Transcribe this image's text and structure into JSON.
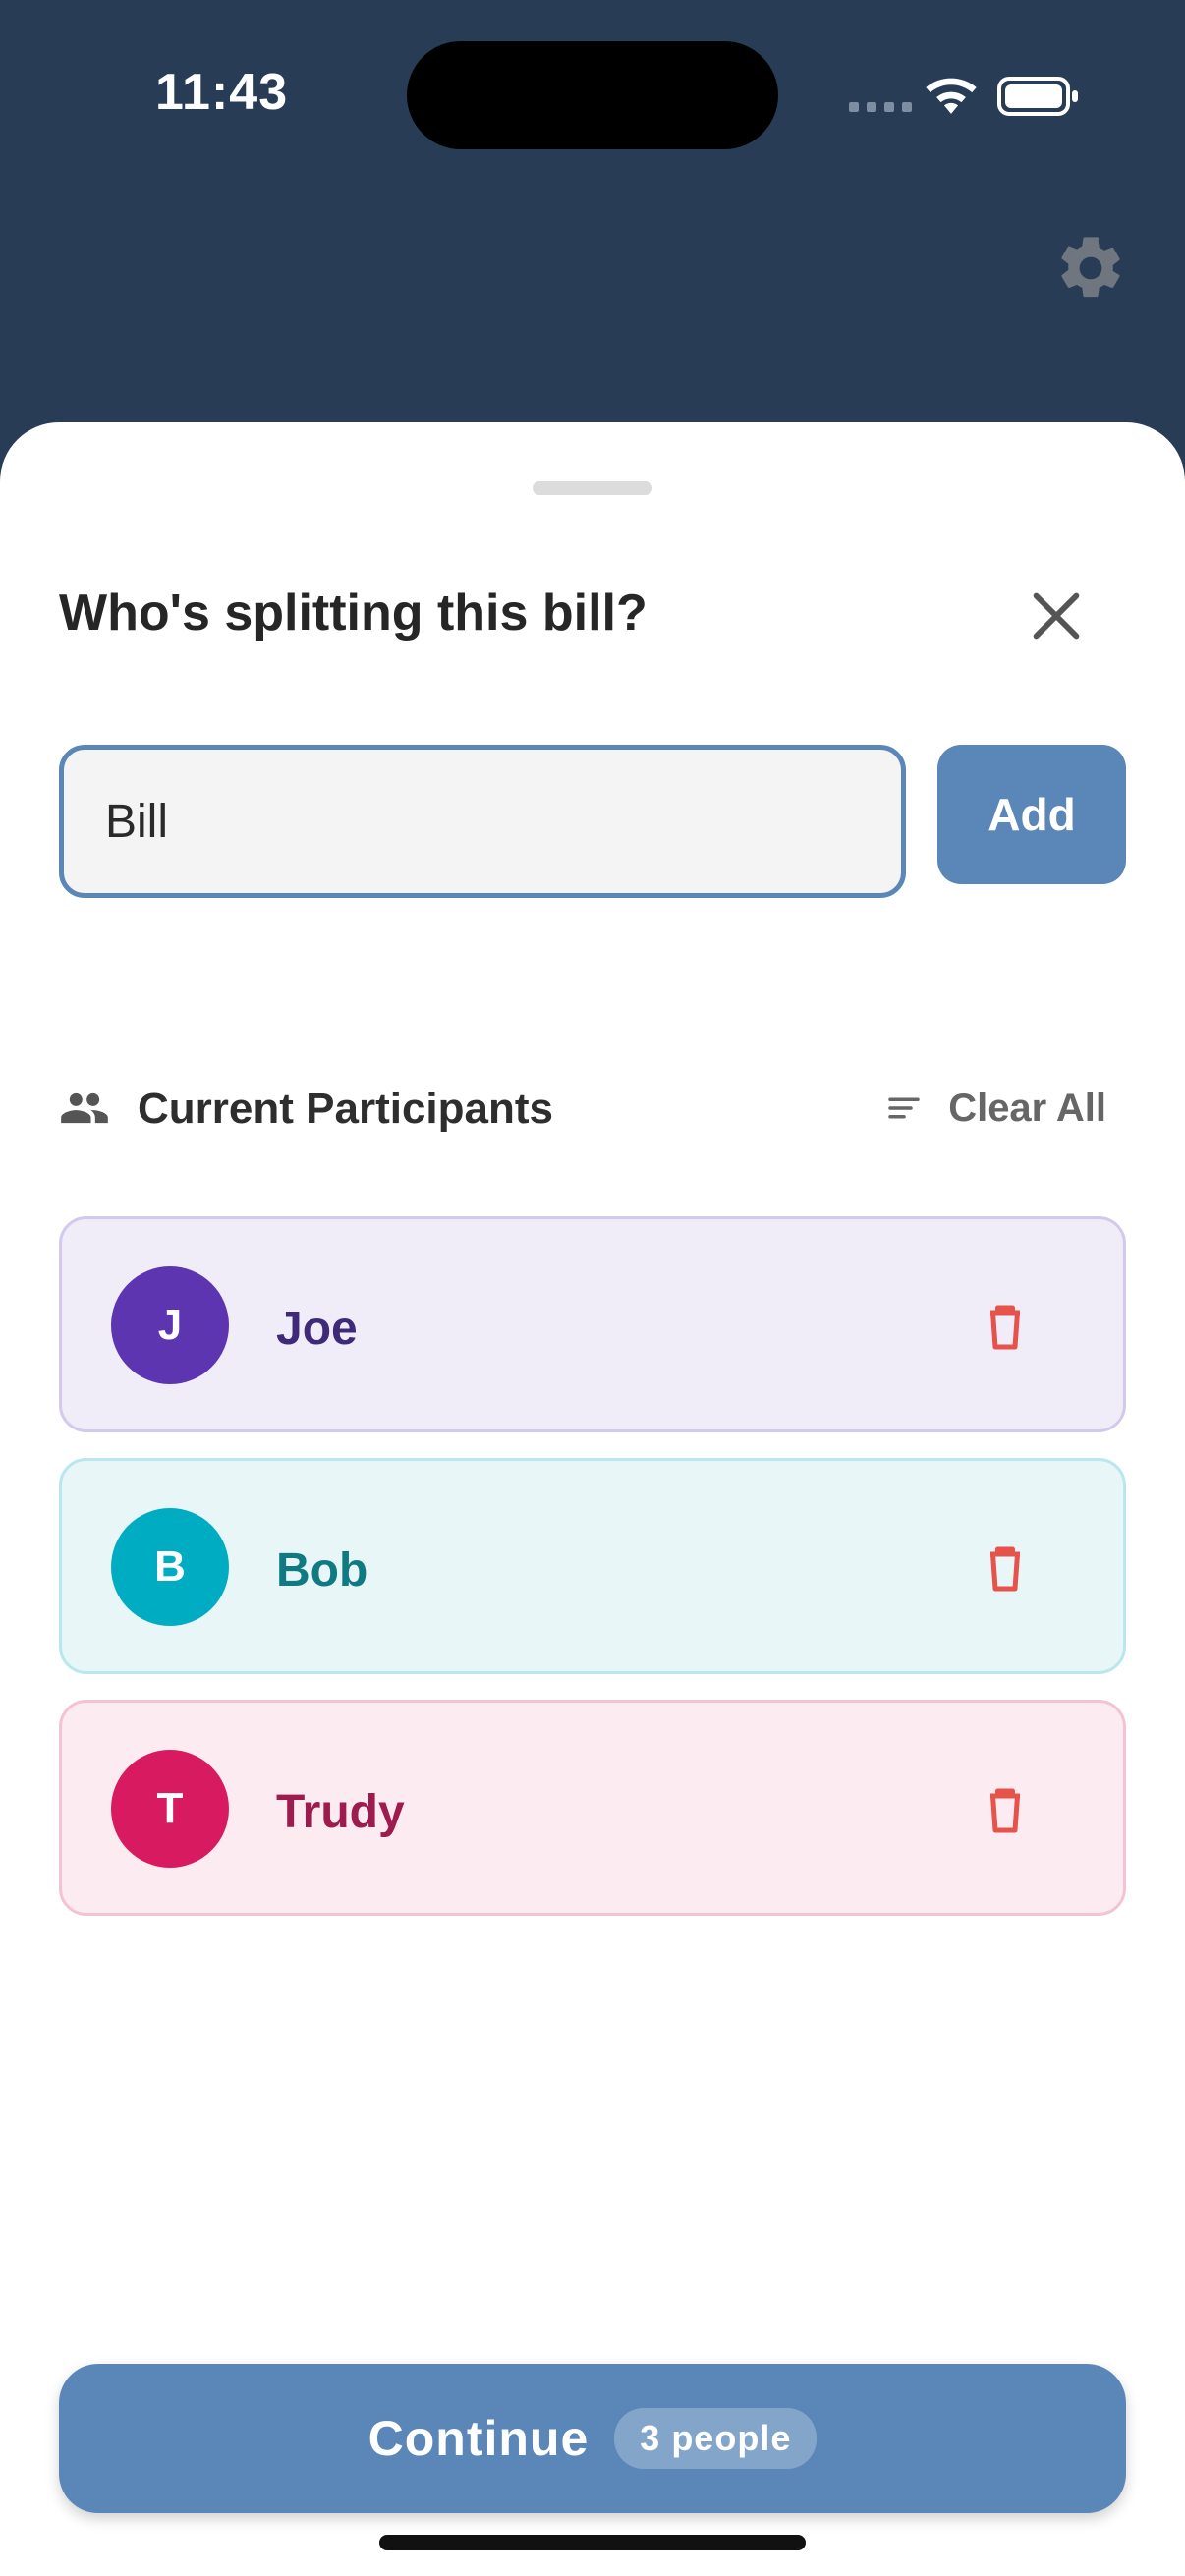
{
  "status_bar": {
    "time": "11:43"
  },
  "sheet": {
    "title": "Who's splitting this bill?",
    "name_input": {
      "value": "Bill",
      "placeholder": ""
    },
    "add_label": "Add",
    "section_title": "Current Participants",
    "clear_all_label": "Clear All",
    "participants": [
      {
        "initial": "J",
        "name": "Joe",
        "avatar_color": "#5e35b1",
        "bg": "#f0edf9",
        "border": "#d3c9ec",
        "text_color": "#3f2a79"
      },
      {
        "initial": "B",
        "name": "Bob",
        "avatar_color": "#00acc1",
        "bg": "#e8f6f8",
        "border": "#b9e7ee",
        "text_color": "#107a83"
      },
      {
        "initial": "T",
        "name": "Trudy",
        "avatar_color": "#d81b60",
        "bg": "#fcecf2",
        "border": "#f3c3d5",
        "text_color": "#9d1b4d"
      }
    ],
    "continue_label": "Continue",
    "people_count": "3 people"
  },
  "colors": {
    "header_bg": "#283d55",
    "accent": "#5a87b8",
    "delete": "#e5534b"
  }
}
